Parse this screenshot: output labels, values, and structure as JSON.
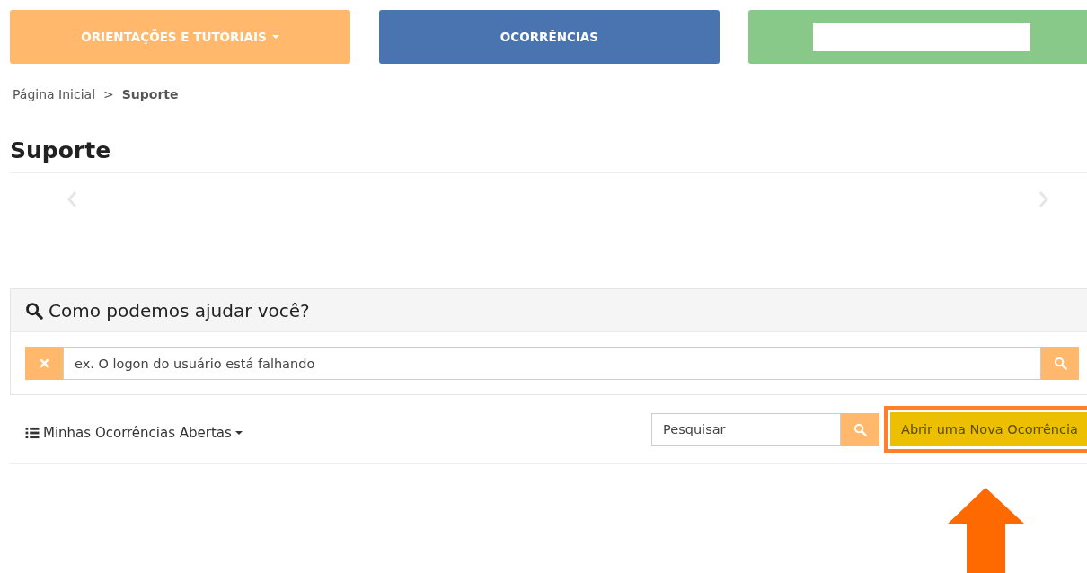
{
  "nav": [
    {
      "label": "ORIENTAÇÕES E TUTORIAIS",
      "color": "#ffb86c",
      "dropdown": true
    },
    {
      "label": "OCORRÊNCIAS",
      "color": "#4a74b0",
      "dropdown": false
    },
    {
      "color": "#88c888",
      "dropdown": false
    }
  ],
  "breadcrumb": [
    {
      "label": "Página Inicial",
      "current": false
    },
    {
      "label": "Suporte",
      "current": true
    }
  ],
  "breadcrumb_separator": ">",
  "title": "Suporte",
  "help_panel": {
    "heading": "Como podemos ajudar você?",
    "search": {
      "placeholder": "ex. O logon do usuário está falhando"
    }
  },
  "toolbar": {
    "menu": "Minhas Ocorrências Abertas",
    "search": {
      "placeholder": "Pesquisar"
    },
    "new_button": "Abrir uma Nova Ocorrência",
    "highlighted": true
  }
}
